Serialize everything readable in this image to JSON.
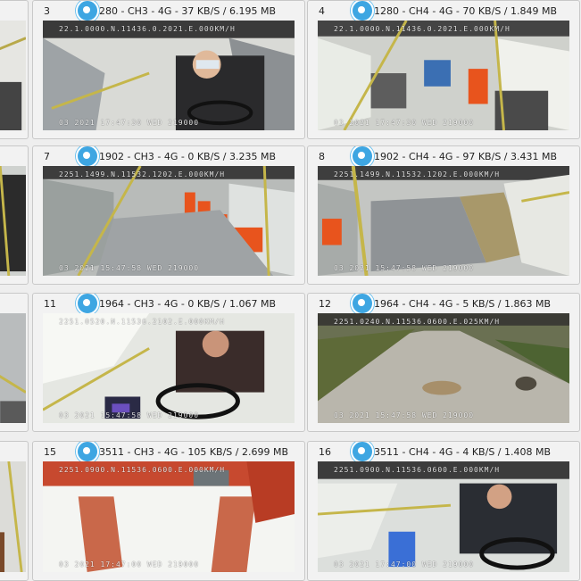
{
  "tiles": [
    {
      "num": "3",
      "info": "1280 - CH3 - 4G - 37 KB/S / 6.195 MB",
      "osd_top": "22.1.0000.N.11436.0.2021.E.000KM/H",
      "osd_bottom": "03 2021 17:47:30 WED  219000"
    },
    {
      "num": "4",
      "info": "21280 - CH4 - 4G - 70 KB/S / 1.849 MB",
      "osd_top": "22.1.0000.N.11436.0.2021.E.000KM/H",
      "osd_bottom": "03 2021 17:47:30 WED  219000"
    },
    {
      "num": "7",
      "info": "21902 - CH3 - 4G - 0 KB/S / 3.235 MB",
      "osd_top": "2251.1499.N.11532.1202.E.000KM/H",
      "osd_bottom": "03 2021 15:47:58 WED  219000"
    },
    {
      "num": "8",
      "info": "21902 - CH4 - 4G - 97 KB/S / 3.431 MB",
      "osd_top": "2251.1499.N.11532.1202.E.000KM/H",
      "osd_bottom": "03 2021 15:47:58 WED  219000"
    },
    {
      "num": "11",
      "info": "21964 - CH3 - 4G - 0 KB/S / 1.067 MB",
      "osd_top": "2251.0520.N.11536.2102.E.000KM/H",
      "osd_bottom": "03 2021 15:47:58 WED  219000"
    },
    {
      "num": "12",
      "info": "21964 - CH4 - 4G - 5 KB/S / 1.863 MB",
      "osd_top": "2251.0240.N.11536.0600.E.025KM/H",
      "osd_bottom": "03 2021 15:47:58 WED  219000"
    },
    {
      "num": "15",
      "info": "23511 - CH3 - 4G - 105 KB/S / 2.699 MB",
      "osd_top": "2251.0900.N.11536.0600.E.000KM/H",
      "osd_bottom": "03 2021 17:47:00 WED  219000"
    },
    {
      "num": "16",
      "info": "23511 - CH4 - 4G - 4 KB/S / 1.408 MB",
      "osd_top": "2251.0900.N.11536.0600.E.000KM/H",
      "osd_bottom": "03 2021 17:47:00 WED  219000"
    }
  ],
  "colors": {
    "pin": "#3ea6e2",
    "seat": "#e8541d",
    "pole": "#c5b64a"
  }
}
